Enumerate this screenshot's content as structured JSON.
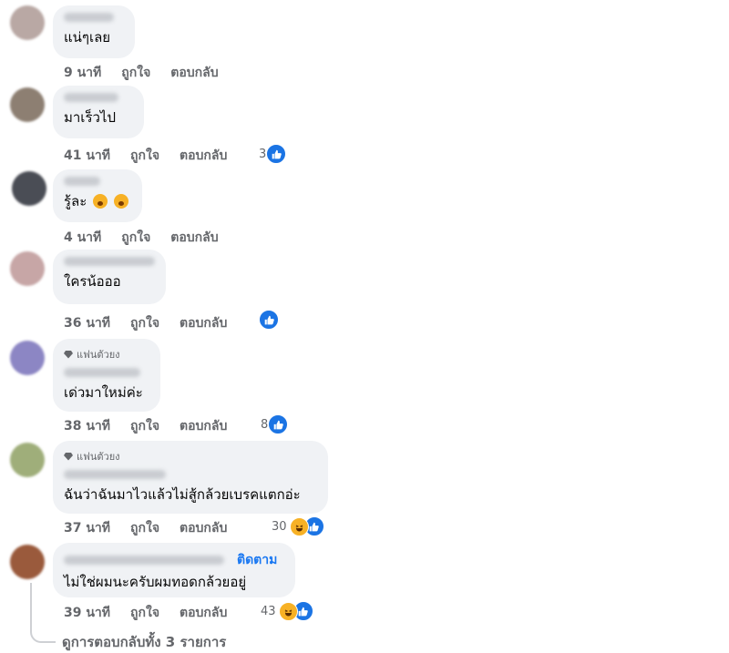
{
  "labels": {
    "like": "ถูกใจ",
    "reply": "ตอบกลับ"
  },
  "comments": [
    {
      "text": "แน่ๆเลย",
      "time": "9 นาที",
      "reaction_count": ""
    },
    {
      "text": "มาเร็วไป",
      "time": "41 นาที",
      "reaction_count": "3"
    },
    {
      "text": "รู้ละ",
      "time": "4 นาที",
      "reaction_count": ""
    },
    {
      "text": "ใครน้อออ",
      "time": "36 นาที",
      "reaction_count": ""
    },
    {
      "badge": "แฟนตัวยง",
      "text": "เด่วมาใหม่ค่ะ",
      "time": "38 นาที",
      "reaction_count": "8"
    },
    {
      "badge": "แฟนตัวยง",
      "text": "ฉันว่าฉันมาไวแล้วไม่สู้กล้วยเบรคแตกอ่ะ",
      "time": "37 นาที",
      "reaction_count": "30"
    },
    {
      "follow": "ติดตาม",
      "text": "ไม่ใช่ผมนะครับผมทอดกล้วยอยู่",
      "time": "39 นาที",
      "reaction_count": "43"
    }
  ],
  "view_replies": "ดูการตอบกลับทั้ง 3 รายการ",
  "icons": [
    "like-icon",
    "haha-icon",
    "gem-icon",
    "astonished-emoji-icon"
  ],
  "colors": {
    "like_blue": "#1b74e4",
    "bubble": "#f0f2f5",
    "link": "#1877f2",
    "meta": "#65676b"
  }
}
